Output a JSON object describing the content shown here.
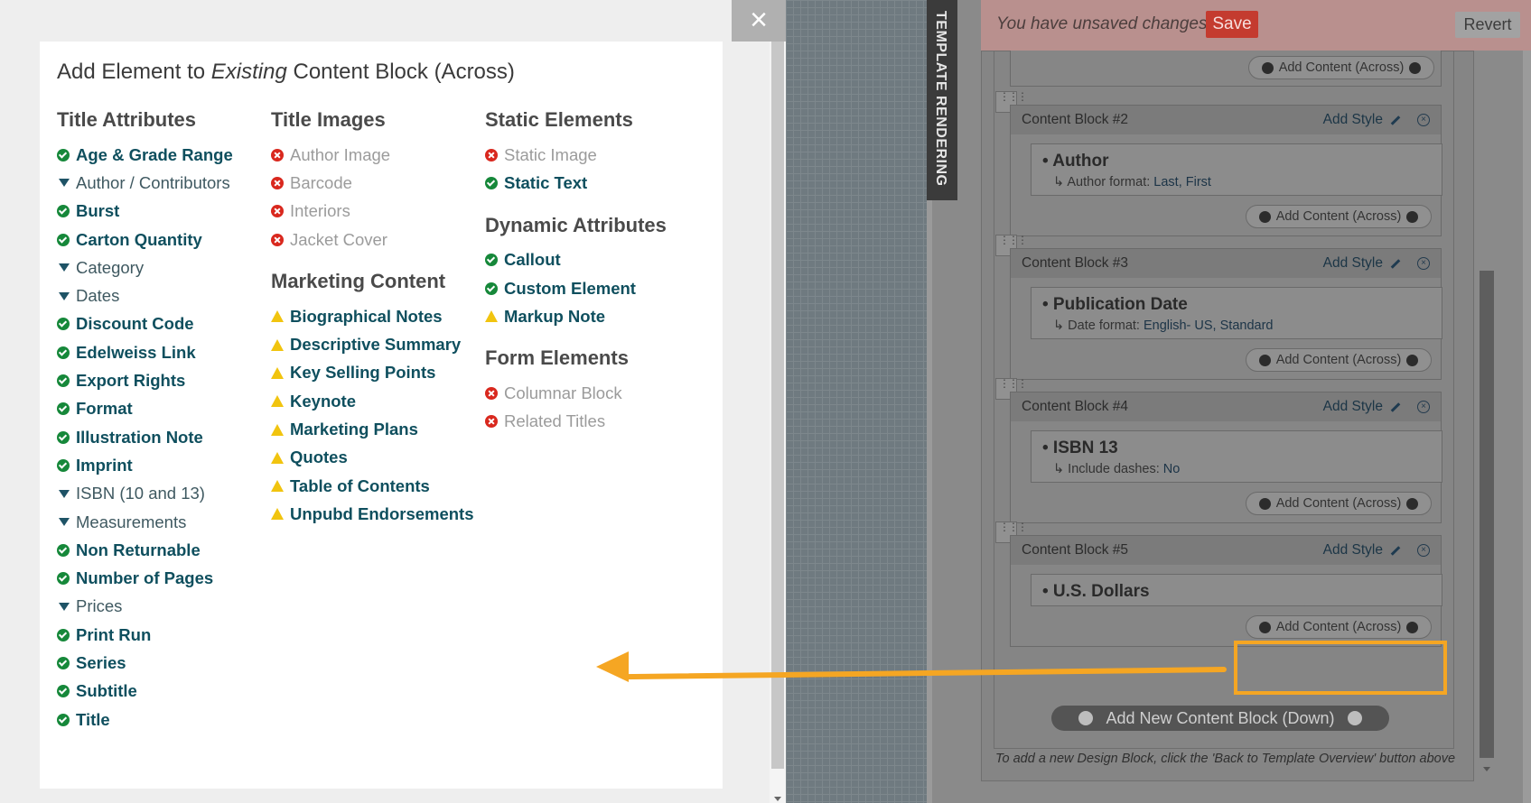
{
  "modal": {
    "title_prefix": "Add Element to ",
    "title_em": "Existing",
    "title_suffix": " Content Block (Across)",
    "close_label": "×",
    "columns": [
      {
        "sections": [
          {
            "heading": "Title Attributes",
            "items": [
              {
                "label": "Age & Grade Range",
                "status": "ok"
              },
              {
                "label": "Author / Contributors",
                "status": "group"
              },
              {
                "label": "Burst",
                "status": "ok"
              },
              {
                "label": "Carton Quantity",
                "status": "ok"
              },
              {
                "label": "Category",
                "status": "group"
              },
              {
                "label": "Dates",
                "status": "group"
              },
              {
                "label": "Discount Code",
                "status": "ok"
              },
              {
                "label": "Edelweiss Link",
                "status": "ok"
              },
              {
                "label": "Export Rights",
                "status": "ok"
              },
              {
                "label": "Format",
                "status": "ok"
              },
              {
                "label": "Illustration Note",
                "status": "ok"
              },
              {
                "label": "Imprint",
                "status": "ok"
              },
              {
                "label": "ISBN (10 and 13)",
                "status": "group"
              },
              {
                "label": "Measurements",
                "status": "group"
              },
              {
                "label": "Non Returnable",
                "status": "ok"
              },
              {
                "label": "Number of Pages",
                "status": "ok"
              },
              {
                "label": "Prices",
                "status": "group"
              },
              {
                "label": "Print Run",
                "status": "ok"
              },
              {
                "label": "Series",
                "status": "ok"
              },
              {
                "label": "Subtitle",
                "status": "ok"
              },
              {
                "label": "Title",
                "status": "ok"
              }
            ]
          }
        ]
      },
      {
        "sections": [
          {
            "heading": "Title Images",
            "items": [
              {
                "label": "Author Image",
                "status": "no"
              },
              {
                "label": "Barcode",
                "status": "no"
              },
              {
                "label": "Interiors",
                "status": "no"
              },
              {
                "label": "Jacket Cover",
                "status": "no"
              }
            ]
          },
          {
            "heading": "Marketing Content",
            "items": [
              {
                "label": "Biographical Notes",
                "status": "warn"
              },
              {
                "label": "Descriptive Summary",
                "status": "warn"
              },
              {
                "label": "Key Selling Points",
                "status": "warn"
              },
              {
                "label": "Keynote",
                "status": "warn"
              },
              {
                "label": "Marketing Plans",
                "status": "warn"
              },
              {
                "label": "Quotes",
                "status": "warn"
              },
              {
                "label": "Table of Contents",
                "status": "warn"
              },
              {
                "label": "Unpubd Endorsements",
                "status": "warn"
              }
            ]
          }
        ]
      },
      {
        "sections": [
          {
            "heading": "Static Elements",
            "items": [
              {
                "label": "Static Image",
                "status": "no"
              },
              {
                "label": "Static Text",
                "status": "ok"
              }
            ]
          },
          {
            "heading": "Dynamic Attributes",
            "items": [
              {
                "label": "Callout",
                "status": "ok"
              },
              {
                "label": "Custom Element",
                "status": "ok"
              },
              {
                "label": "Markup Note",
                "status": "warn"
              }
            ]
          },
          {
            "heading": "Form Elements",
            "items": [
              {
                "label": "Columnar Block",
                "status": "no"
              },
              {
                "label": "Related Titles",
                "status": "no"
              }
            ]
          }
        ]
      }
    ]
  },
  "editor": {
    "render_tab": "TEMPLATE RENDERING",
    "unsaved_text": "You have unsaved changes",
    "save_label": "Save",
    "revert_label": "Revert",
    "add_content_label": "Add Content (Across)",
    "add_style_label": "Add Style",
    "blocks": [
      {
        "title": "Content Block #2",
        "field": "• Author",
        "desc_label": "↳ Author format: ",
        "desc_value": "Last, First"
      },
      {
        "title": "Content Block #3",
        "field": "• Publication Date",
        "desc_label": "↳ Date format: ",
        "desc_value": "English- US, Standard"
      },
      {
        "title": "Content Block #4",
        "field": "• ISBN 13",
        "desc_label": "↳ Include dashes: ",
        "desc_value": "No"
      },
      {
        "title": "Content Block #5",
        "field": "• U.S. Dollars",
        "desc_label": "",
        "desc_value": ""
      }
    ],
    "add_new_label": "Add New Content Block (Down)",
    "hint": "To add a new Design Block, click the 'Back to Template Overview' button above"
  },
  "colors": {
    "ok": "#16883a",
    "no": "#d9281e",
    "warn": "#f1c40f",
    "highlight": "#f5a623",
    "save": "#c43b2f"
  }
}
